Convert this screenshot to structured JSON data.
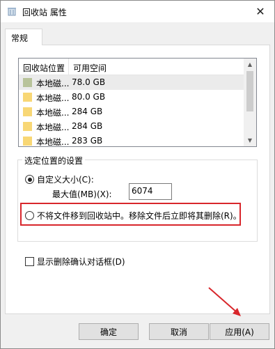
{
  "window": {
    "title": "回收站 属性",
    "close_glyph": "✕"
  },
  "tabs": [
    {
      "label": "常规"
    }
  ],
  "list": {
    "headers": [
      "回收站位置",
      "可用空间"
    ],
    "rows": [
      {
        "name": "本地磁...",
        "size": "78.0 GB",
        "selected": true
      },
      {
        "name": "本地磁...",
        "size": "80.0 GB"
      },
      {
        "name": "本地磁...",
        "size": "284 GB"
      },
      {
        "name": "本地磁...",
        "size": "284 GB"
      },
      {
        "name": "本地磁...",
        "size": "283 GB"
      }
    ]
  },
  "settings": {
    "group_label": "选定位置的设置",
    "custom_size_label": "自定义大小(C):",
    "max_size_label": "最大值(MB)(X):",
    "max_size_value": "6074",
    "delete_immediately_label": "不将文件移到回收站中。移除文件后立即将其删除(R)。"
  },
  "confirm_dialog_label": "显示删除确认对话框(D)",
  "buttons": {
    "ok": "确定",
    "cancel": "取消",
    "apply": "应用(A)"
  },
  "colors": {
    "annotation_red": "#d8262b",
    "folder_yellow": "#f8d775",
    "folder_selected": "#b8c39a"
  }
}
